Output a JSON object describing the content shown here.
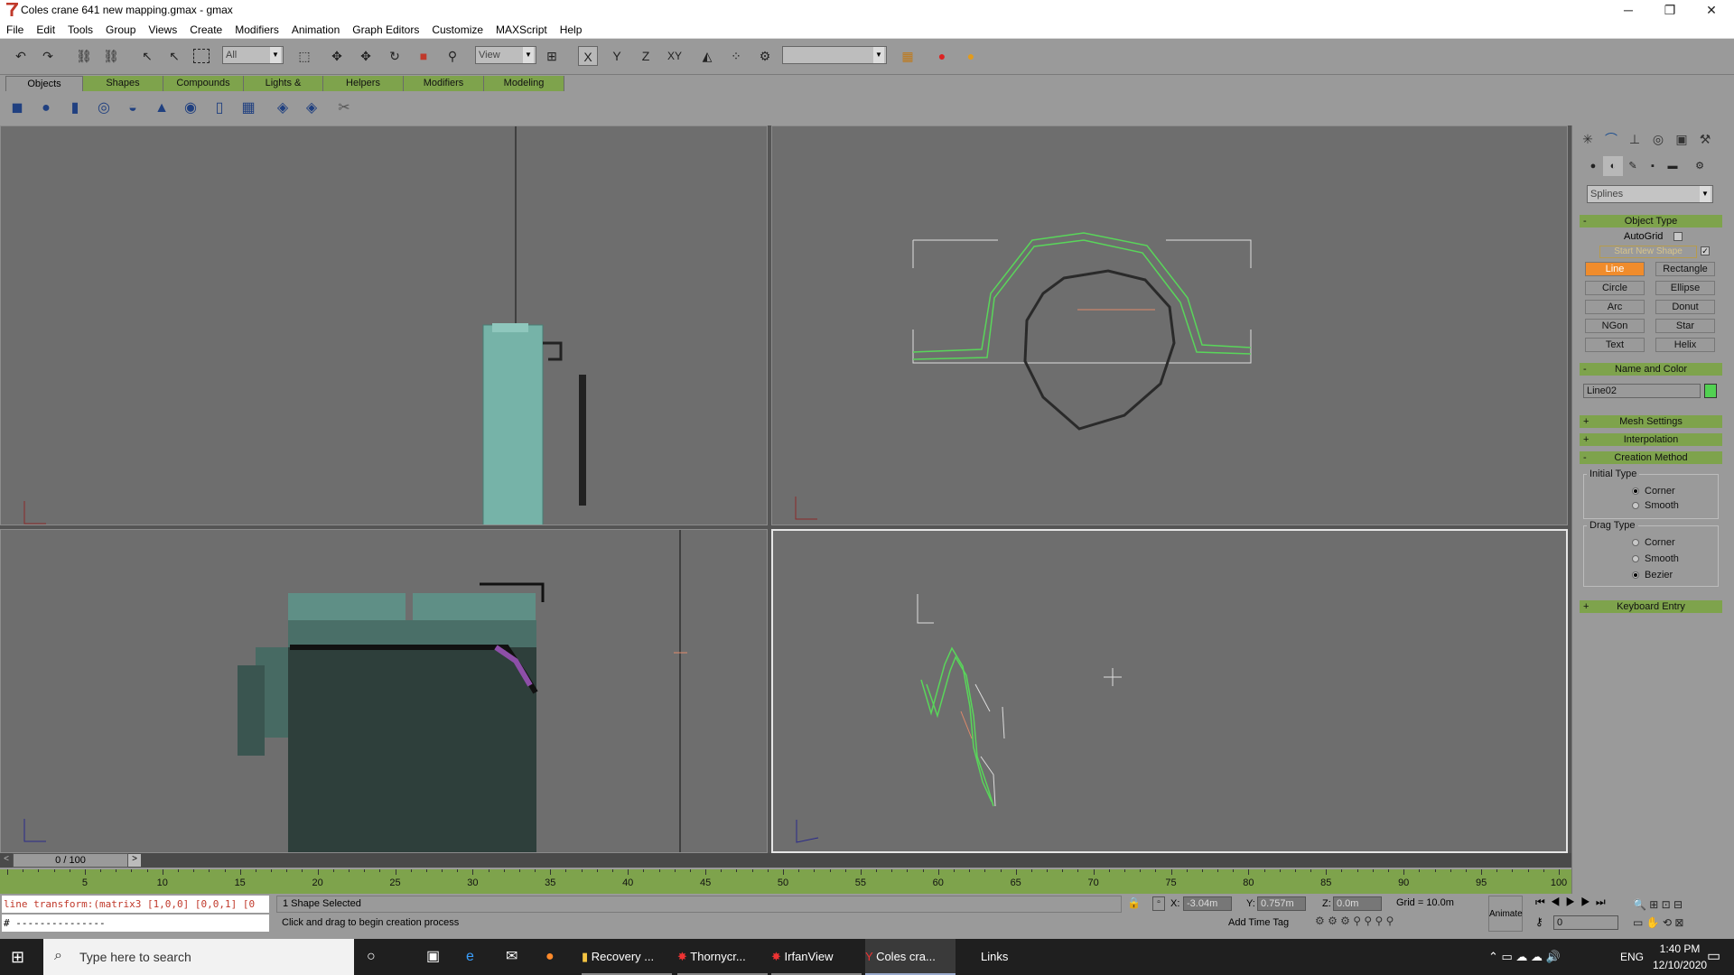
{
  "window": {
    "title": "Coles crane 641 new mapping.gmax - gmax",
    "controls": {
      "minimize": "─",
      "restore": "❐",
      "close": "✕"
    }
  },
  "menu": [
    "File",
    "Edit",
    "Tools",
    "Group",
    "Views",
    "Create",
    "Modifiers",
    "Animation",
    "Graph Editors",
    "Customize",
    "MAXScript",
    "Help"
  ],
  "toolbar": {
    "selection_filter": "All",
    "reference_coord": "View",
    "axis_x": "X",
    "axis_y": "Y",
    "axis_z": "Z",
    "axis_xy": "XY",
    "named_selection": ""
  },
  "tabs": [
    "Objects",
    "Shapes",
    "Compounds",
    "Lights & Cameras",
    "Helpers",
    "Modifiers",
    "Modeling"
  ],
  "command_panel": {
    "category": "Splines",
    "object_type": {
      "header": "Object Type",
      "autogrid_label": "AutoGrid",
      "start_new_shape_label": "Start New Shape",
      "buttons": [
        "Line",
        "Rectangle",
        "Circle",
        "Ellipse",
        "Arc",
        "Donut",
        "NGon",
        "Star",
        "Text",
        "Helix"
      ],
      "active": "Line"
    },
    "name_and_color": {
      "header": "Name and Color",
      "name": "Line02",
      "color": "#52d152"
    },
    "mesh_settings": "Mesh Settings",
    "interpolation": "Interpolation",
    "creation_method": {
      "header": "Creation Method",
      "initial_type_label": "Initial Type",
      "initial_options": [
        "Corner",
        "Smooth"
      ],
      "initial_selected": "Corner",
      "drag_type_label": "Drag Type",
      "drag_options": [
        "Corner",
        "Smooth",
        "Bezier"
      ],
      "drag_selected": "Bezier"
    },
    "keyboard_entry": "Keyboard Entry",
    "plus": "+",
    "minus": "-"
  },
  "timeline": {
    "frame_counter": "0 / 100",
    "ticks": [
      "5",
      "10",
      "15",
      "20",
      "25",
      "30",
      "35",
      "40",
      "45",
      "50",
      "55",
      "60",
      "65",
      "70",
      "75",
      "80",
      "85",
      "90",
      "95",
      "100"
    ],
    "prev": "<",
    "next": ">"
  },
  "status": {
    "script_output": "line transform:(matrix3 [1,0,0] [0,0,1] [0",
    "script_input": "# ---------------",
    "selection": "1 Shape Selected",
    "prompt": "Click and drag to begin creation process",
    "x_label": "X:",
    "x_value": "-3.04m",
    "y_label": "Y:",
    "y_value": "0.757m",
    "z_label": "Z:",
    "z_value": "0.0m",
    "grid": "Grid = 10.0m",
    "add_time_tag": "Add Time Tag",
    "animate": "Animate",
    "frame_field": "0"
  },
  "taskbar": {
    "search_placeholder": "Type here to search",
    "apps": [
      "Recovery ...",
      "Thornycr...",
      "IrfanView",
      "Coles cra..."
    ],
    "links": "Links",
    "lang": "ENG",
    "time": "1:40 PM",
    "date": "12/10/2020"
  }
}
